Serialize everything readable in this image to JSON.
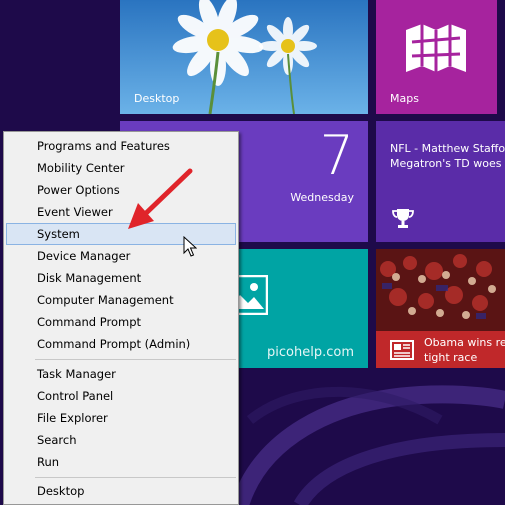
{
  "tiles": {
    "desktop": {
      "label": "Desktop"
    },
    "maps": {
      "label": "Maps"
    },
    "calendar": {
      "day_number": "7",
      "weekday": "Wednesday"
    },
    "sports": {
      "headline_line1": "NFL - Matthew Staffo",
      "headline_line2": "Megatron's TD woes"
    },
    "photos": {
      "watermark": "picohelp.com"
    },
    "news": {
      "headline_line1": "Obama wins re",
      "headline_line2": "tight race"
    }
  },
  "menu": {
    "items": [
      {
        "label": "Programs and Features"
      },
      {
        "label": "Mobility Center"
      },
      {
        "label": "Power Options"
      },
      {
        "label": "Event Viewer"
      },
      {
        "label": "System",
        "highlighted": true
      },
      {
        "label": "Device Manager"
      },
      {
        "label": "Disk Management"
      },
      {
        "label": "Computer Management"
      },
      {
        "label": "Command Prompt"
      },
      {
        "label": "Command Prompt (Admin)"
      },
      {
        "label": "Task Manager"
      },
      {
        "label": "Control Panel"
      },
      {
        "label": "File Explorer"
      },
      {
        "label": "Search"
      },
      {
        "label": "Run"
      },
      {
        "label": "Desktop"
      }
    ]
  },
  "colors": {
    "background": "#1e0a4a",
    "menu_bg": "#f0f0f0",
    "menu_highlight": "#d9e5f4",
    "arrow": "#e0242a"
  },
  "icons": [
    "maps-icon",
    "trophy-icon",
    "photos-icon",
    "news-icon",
    "red-arrow-annotation",
    "mouse-cursor-icon"
  ]
}
